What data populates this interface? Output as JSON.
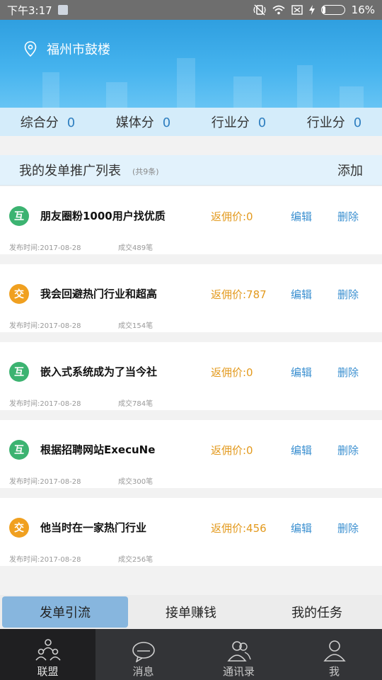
{
  "status_bar": {
    "time": "下午3:17",
    "battery": "16%",
    "battery_level": 0.16
  },
  "location": {
    "text": "福州市鼓楼"
  },
  "scores": [
    {
      "label": "综合分",
      "value": "0"
    },
    {
      "label": "媒体分",
      "value": "0"
    },
    {
      "label": "行业分",
      "value": "0"
    },
    {
      "label": "行业分",
      "value": "0"
    }
  ],
  "list": {
    "title": "我的发单推广列表",
    "count": "(共9条)",
    "add_label": "添加",
    "items": [
      {
        "badge": "互",
        "badge_color": "#3cb371",
        "name": "朋友圈粉1000用户找优质",
        "price": "返佣价:0",
        "edit": "编辑",
        "delete": "删除",
        "date": "发布时间:2017-08-28",
        "deals": "成交489笔"
      },
      {
        "badge": "交",
        "badge_color": "#f0a020",
        "name": "我会回避热门行业和超高",
        "price": "返佣价:787",
        "edit": "编辑",
        "delete": "删除",
        "date": "发布时间:2017-08-28",
        "deals": "成交154笔"
      },
      {
        "badge": "互",
        "badge_color": "#3cb371",
        "name": "嵌入式系统成为了当今社",
        "price": "返佣价:0",
        "edit": "编辑",
        "delete": "删除",
        "date": "发布时间:2017-08-28",
        "deals": "成交784笔"
      },
      {
        "badge": "互",
        "badge_color": "#3cb371",
        "name": "根据招聘网站ExecuNe",
        "price": "返佣价:0",
        "edit": "编辑",
        "delete": "删除",
        "date": "发布时间:2017-08-28",
        "deals": "成交300笔"
      },
      {
        "badge": "交",
        "badge_color": "#f0a020",
        "name": "他当时在一家热门行业",
        "price": "返佣价:456",
        "edit": "编辑",
        "delete": "删除",
        "date": "发布时间:2017-08-28",
        "deals": "成交256笔"
      }
    ]
  },
  "sub_tabs": [
    {
      "label": "发单引流",
      "active": true
    },
    {
      "label": "接单赚钱",
      "active": false
    },
    {
      "label": "我的任务",
      "active": false
    }
  ],
  "tab_bar": [
    {
      "label": "联盟",
      "icon": "alliance-icon",
      "active": true
    },
    {
      "label": "消息",
      "icon": "message-icon",
      "active": false
    },
    {
      "label": "通讯录",
      "icon": "contacts-icon",
      "active": false
    },
    {
      "label": "我",
      "icon": "profile-icon",
      "active": false
    }
  ],
  "colors": {
    "accent_blue": "#3a8fd0",
    "price_orange": "#e39a1e",
    "header_blue": "#45b3ee"
  }
}
